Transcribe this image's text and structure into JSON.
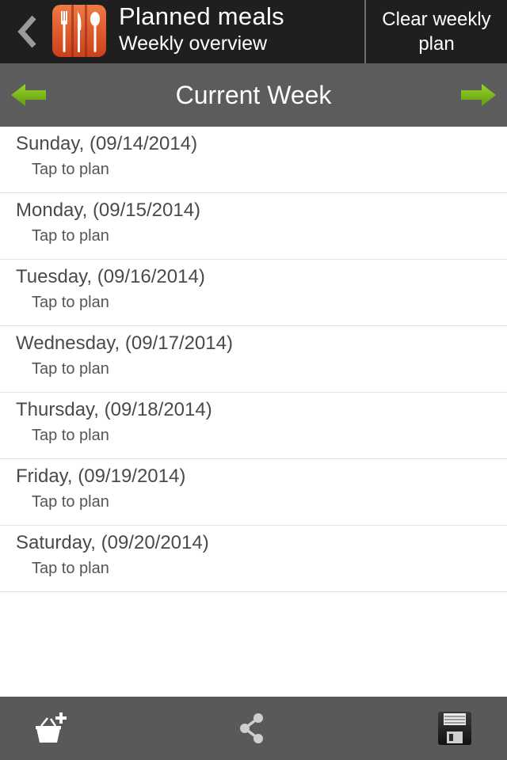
{
  "header": {
    "title": "Planned meals",
    "subtitle": "Weekly overview",
    "clear_label": "Clear weekly plan",
    "back_icon": "back-chevron-icon",
    "app_icon": "cutlery-app-icon"
  },
  "week_nav": {
    "title": "Current Week",
    "prev_icon": "arrow-left-icon",
    "next_icon": "arrow-right-icon",
    "arrow_color": "#7cb518"
  },
  "days": [
    {
      "date": "Sunday, (09/14/2014)",
      "hint": "Tap to plan"
    },
    {
      "date": "Monday, (09/15/2014)",
      "hint": "Tap to plan"
    },
    {
      "date": "Tuesday, (09/16/2014)",
      "hint": "Tap to plan"
    },
    {
      "date": "Wednesday, (09/17/2014)",
      "hint": "Tap to plan"
    },
    {
      "date": "Thursday, (09/18/2014)",
      "hint": "Tap to plan"
    },
    {
      "date": "Friday, (09/19/2014)",
      "hint": "Tap to plan"
    },
    {
      "date": "Saturday, (09/20/2014)",
      "hint": "Tap to plan"
    }
  ],
  "toolbar": {
    "add_to_cart_icon": "add-to-basket-icon",
    "share_icon": "share-icon",
    "save_icon": "floppy-disk-icon"
  },
  "colors": {
    "header_bg": "#1f1f1f",
    "week_bar_bg": "#5c5c5c",
    "toolbar_bg": "#595959",
    "app_icon_orange": "#e05a2b"
  }
}
